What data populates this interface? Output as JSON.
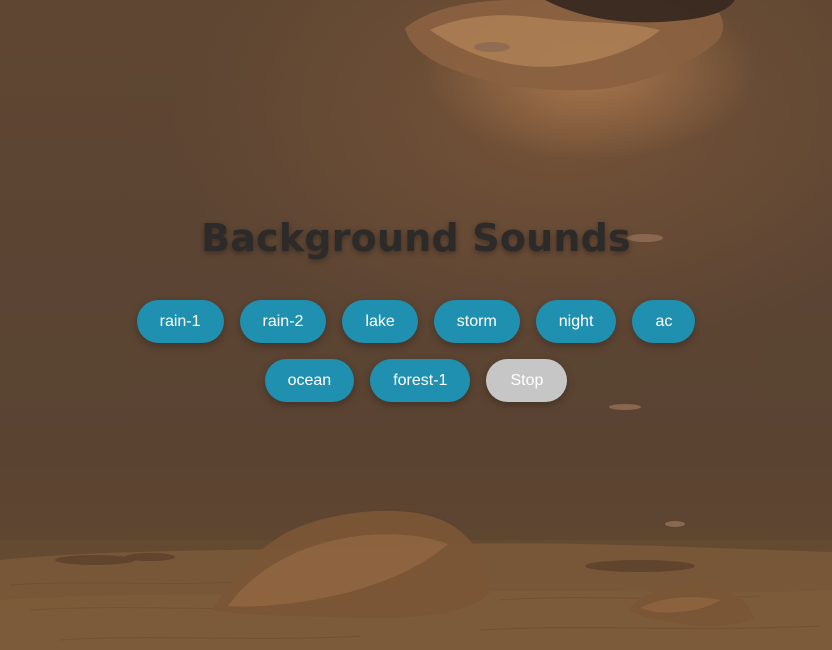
{
  "page": {
    "title": "Background Sounds"
  },
  "sounds": [
    {
      "label": "rain-1"
    },
    {
      "label": "rain-2"
    },
    {
      "label": "lake"
    },
    {
      "label": "storm"
    },
    {
      "label": "night"
    },
    {
      "label": "ac"
    },
    {
      "label": "ocean"
    },
    {
      "label": "forest-1"
    }
  ],
  "controls": {
    "stop_label": "Stop"
  },
  "colors": {
    "sound_button": "#2090b0",
    "stop_button": "#c6c6c6",
    "title_text": "#2d2a2a",
    "button_text": "#ffffff"
  }
}
